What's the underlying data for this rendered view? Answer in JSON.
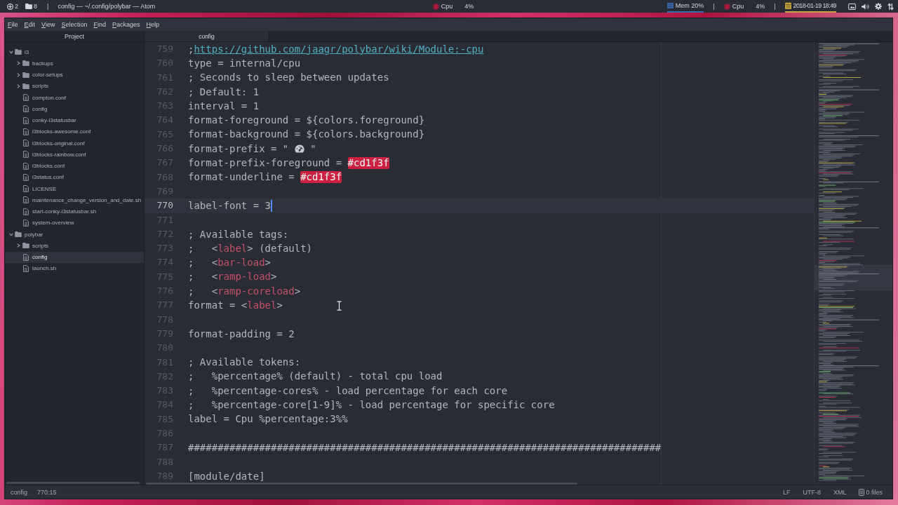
{
  "topbar": {
    "left": [
      {
        "kind": "workspace",
        "label": "2"
      },
      {
        "kind": "folder",
        "label": "8"
      },
      {
        "kind": "separator",
        "label": "|"
      },
      {
        "kind": "title",
        "label": "config — ~/.config/polybar — Atom"
      }
    ],
    "center": [
      {
        "kind": "cpu",
        "label": "Cpu",
        "value": "4%",
        "color": "#b01a3c",
        "underlined": false
      }
    ],
    "right": [
      {
        "kind": "memory",
        "label": "Mem 20%",
        "color": "#3b6cb0",
        "underlined": true
      },
      {
        "kind": "separator",
        "label": "|"
      },
      {
        "kind": "cpu",
        "label": "Cpu",
        "value": "4%",
        "color": "#b01a3c",
        "underlined": false
      },
      {
        "kind": "separator",
        "label": "|"
      },
      {
        "kind": "date",
        "label": "2018-01-19 18:49",
        "color": "#c9a43a",
        "underlined": true
      }
    ],
    "tray": [
      {
        "kind": "screen"
      },
      {
        "kind": "volume"
      },
      {
        "kind": "settings"
      },
      {
        "kind": "network"
      }
    ]
  },
  "menu": [
    "File",
    "Edit",
    "View",
    "Selection",
    "Find",
    "Packages",
    "Help"
  ],
  "tree": {
    "title": "Project",
    "items": [
      {
        "label": "i3",
        "kind": "folder",
        "expanded": true,
        "selected": false,
        "children": [
          {
            "label": "backups",
            "kind": "folder",
            "expanded": false,
            "selected": false
          },
          {
            "label": "color-setups",
            "kind": "folder",
            "expanded": false,
            "selected": false
          },
          {
            "label": "scripts",
            "kind": "folder",
            "expanded": false,
            "selected": false
          },
          {
            "label": "compton.conf",
            "kind": "file",
            "selected": false
          },
          {
            "label": "config",
            "kind": "file",
            "selected": false
          },
          {
            "label": "conky-i3statusbar",
            "kind": "file",
            "selected": false
          },
          {
            "label": "i3blocks-awesome.conf",
            "kind": "file",
            "selected": false
          },
          {
            "label": "i3blocks-original.conf",
            "kind": "file",
            "selected": false
          },
          {
            "label": "i3blocks-rainbow.conf",
            "kind": "file",
            "selected": false
          },
          {
            "label": "i3blocks.conf",
            "kind": "file",
            "selected": false
          },
          {
            "label": "i3status.conf",
            "kind": "file",
            "selected": false
          },
          {
            "label": "LICENSE",
            "kind": "file",
            "selected": false
          },
          {
            "label": "maintenance_change_version_and_date.sh",
            "kind": "file",
            "selected": false
          },
          {
            "label": "start-conky-i3statusbar.sh",
            "kind": "file",
            "selected": false
          },
          {
            "label": "system-overview",
            "kind": "file",
            "selected": false
          }
        ]
      },
      {
        "label": "polybar",
        "kind": "folder",
        "expanded": true,
        "selected": false,
        "children": [
          {
            "label": "scripts",
            "kind": "folder",
            "expanded": false,
            "selected": false
          },
          {
            "label": "config",
            "kind": "file",
            "selected": true
          },
          {
            "label": "launch.sh",
            "kind": "file",
            "selected": false
          }
        ]
      }
    ]
  },
  "tabs": [
    {
      "label": "config",
      "selected": true
    }
  ],
  "editor": {
    "lines": [
      {
        "number": "759",
        "current": false,
        "segments": [
          {
            "kind": "text",
            "text": ";"
          },
          {
            "kind": "link",
            "text": "https://github.com/jaagr/polybar/wiki/Module:-cpu"
          }
        ]
      },
      {
        "number": "760",
        "current": false,
        "segments": [
          {
            "kind": "text",
            "text": "type = internal/cpu"
          }
        ]
      },
      {
        "number": "761",
        "current": false,
        "segments": [
          {
            "kind": "text",
            "text": "; Seconds to sleep between updates"
          }
        ]
      },
      {
        "number": "762",
        "current": false,
        "segments": [
          {
            "kind": "text",
            "text": "; Default: 1"
          }
        ]
      },
      {
        "number": "763",
        "current": false,
        "segments": [
          {
            "kind": "text",
            "text": "interval = 1"
          }
        ]
      },
      {
        "number": "764",
        "current": false,
        "segments": [
          {
            "kind": "text",
            "text": "format-foreground = ${colors.foreground}"
          }
        ]
      },
      {
        "number": "765",
        "current": false,
        "segments": [
          {
            "kind": "text",
            "text": "format-background = ${colors.background}"
          }
        ]
      },
      {
        "number": "766",
        "current": false,
        "segments": [
          {
            "kind": "text",
            "text": "format-prefix = \" "
          },
          {
            "kind": "icon"
          },
          {
            "kind": "text",
            "text": " \""
          }
        ]
      },
      {
        "number": "767",
        "current": false,
        "segments": [
          {
            "kind": "text",
            "text": "format-prefix-foreground = "
          },
          {
            "kind": "color",
            "text": "#cd1f3f",
            "color": "#cd1f3f"
          }
        ]
      },
      {
        "number": "768",
        "current": false,
        "segments": [
          {
            "kind": "text",
            "text": "format-underline = "
          },
          {
            "kind": "color",
            "text": "#cd1f3f",
            "color": "#cd1f3f"
          }
        ]
      },
      {
        "number": "769",
        "current": false
      },
      {
        "number": "770",
        "current": true,
        "segments": [
          {
            "kind": "text",
            "text": "label-font = 3"
          }
        ]
      },
      {
        "number": "771",
        "current": false
      },
      {
        "number": "772",
        "current": false,
        "segments": [
          {
            "kind": "text",
            "text": "; Available tags:"
          }
        ]
      },
      {
        "number": "773",
        "current": false,
        "segments": [
          {
            "kind": "text",
            "text": ";   <"
          },
          {
            "kind": "tag",
            "text": "label"
          },
          {
            "kind": "text",
            "text": "> (default)"
          }
        ]
      },
      {
        "number": "774",
        "current": false,
        "segments": [
          {
            "kind": "text",
            "text": ";   <"
          },
          {
            "kind": "tag",
            "text": "bar-load"
          },
          {
            "kind": "text",
            "text": ">"
          }
        ]
      },
      {
        "number": "775",
        "current": false,
        "segments": [
          {
            "kind": "text",
            "text": ";   <"
          },
          {
            "kind": "tag",
            "text": "ramp-load"
          },
          {
            "kind": "text",
            "text": ">"
          }
        ]
      },
      {
        "number": "776",
        "current": false,
        "segments": [
          {
            "kind": "text",
            "text": ";   <"
          },
          {
            "kind": "tag",
            "text": "ramp-coreload"
          },
          {
            "kind": "text",
            "text": ">"
          }
        ]
      },
      {
        "number": "777",
        "current": false,
        "segments": [
          {
            "kind": "text",
            "text": "format = <"
          },
          {
            "kind": "tag",
            "text": "label"
          },
          {
            "kind": "text",
            "text": ">"
          }
        ]
      },
      {
        "number": "778",
        "current": false
      },
      {
        "number": "779",
        "current": false,
        "segments": [
          {
            "kind": "text",
            "text": "format-padding = 2"
          }
        ]
      },
      {
        "number": "780",
        "current": false
      },
      {
        "number": "781",
        "current": false,
        "segments": [
          {
            "kind": "text",
            "text": "; Available tokens:"
          }
        ]
      },
      {
        "number": "782",
        "current": false,
        "segments": [
          {
            "kind": "text",
            "text": ";   %percentage% (default) - total cpu load"
          }
        ]
      },
      {
        "number": "783",
        "current": false,
        "segments": [
          {
            "kind": "text",
            "text": ";   %percentage-cores% - load percentage for each core"
          }
        ]
      },
      {
        "number": "784",
        "current": false,
        "segments": [
          {
            "kind": "text",
            "text": ";   %percentage-core[1-9]% - load percentage for specific core"
          }
        ]
      },
      {
        "number": "785",
        "current": false,
        "segments": [
          {
            "kind": "text",
            "text": "label = Cpu %percentage:3%%"
          }
        ]
      },
      {
        "number": "786",
        "current": false
      },
      {
        "number": "787",
        "current": false,
        "segments": [
          {
            "kind": "text",
            "text": "################################################################################"
          }
        ]
      },
      {
        "number": "788",
        "current": false
      },
      {
        "number": "789",
        "current": false,
        "segments": [
          {
            "kind": "text",
            "text": "[module/date]"
          }
        ]
      }
    ]
  },
  "status_bar": {
    "file": "config",
    "position": "770:15",
    "line_ending": "LF",
    "encoding": "UTF-8",
    "grammar": "XML",
    "git": "0 files"
  }
}
